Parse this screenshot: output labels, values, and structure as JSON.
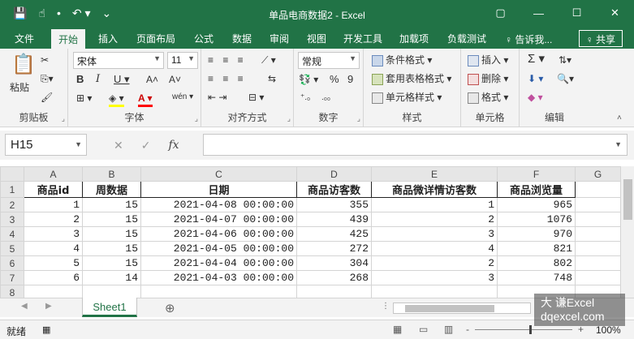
{
  "window": {
    "title": "单品电商数据2 - Excel",
    "minimize_glyph": "—",
    "restore_glyph": "▢",
    "maximize_glyph": "☐",
    "close_glyph": "✕"
  },
  "qat": {
    "save_glyph": "💾",
    "touch_glyph": "☝",
    "dot_glyph": "•",
    "undo_glyph": "↶ ▾",
    "more_glyph": "⌄"
  },
  "tabs": [
    "文件",
    "开始",
    "插入",
    "页面布局",
    "公式",
    "数据",
    "审阅",
    "视图",
    "开发工具",
    "加载项",
    "负载测试"
  ],
  "active_tab": "开始",
  "tell_me": "♀ 告诉我...",
  "share": "♀ 共享",
  "ribbon": {
    "clipboard": {
      "label": "剪贴板",
      "paste": "粘贴",
      "paste_glyph": "📋",
      "cut_glyph": "✂",
      "copy_glyph": "⎘▾",
      "painter_glyph": "🖌"
    },
    "font": {
      "label": "字体",
      "name": "宋体",
      "size": "11",
      "grow": "A˄",
      "shrink": "A˅",
      "bold": "B",
      "italic": "I",
      "underline": "U ▾",
      "border": "⊞ ▾",
      "fill": "◈ ▾",
      "color": "A ▾",
      "phonetic": "wén ▾",
      "fill_color": "#ffff00",
      "font_color": "#ff0000"
    },
    "alignment": {
      "label": "对齐方式",
      "row1": "≡ ≡ ≡",
      "row2": "≡ ≡ ≡",
      "wrap": "⇆",
      "merge": "⊟ ▾",
      "indent": "⇤ ⇥",
      "orient": "⟋ ▾"
    },
    "number": {
      "label": "数字",
      "format": "常规",
      "currency": "💱 ▾",
      "percent": "%",
      "comma": "9",
      "inc_decimal": "⁺.₀",
      "dec_decimal": ".₀₀"
    },
    "styles": {
      "label": "样式",
      "conditional": "条件格式 ▾",
      "table": "套用表格格式 ▾",
      "cell": "单元格样式 ▾"
    },
    "cells": {
      "label": "单元格",
      "insert": "插入 ▾",
      "delete": "删除 ▾",
      "format": "格式 ▾"
    },
    "editing": {
      "label": "编辑",
      "sum": "Σ ▾",
      "sort": "⇅▾",
      "fill": "⬇ ▾",
      "find": "🔍▾",
      "clear": "◆ ▾"
    }
  },
  "formula_bar": {
    "name_box": "H15",
    "cancel": "✕",
    "enter": "✓",
    "fx": "fx",
    "value": ""
  },
  "sheet": {
    "columns": [
      "A",
      "B",
      "C",
      "D",
      "E",
      "F",
      "G"
    ],
    "row_numbers": [
      "1",
      "2",
      "3",
      "4",
      "5",
      "6",
      "7",
      "8"
    ],
    "headers": [
      "商品id",
      "周数据",
      "日期",
      "商品访客数",
      "商品微详情访客数",
      "商品浏览量"
    ],
    "rows": [
      [
        "1",
        "15",
        "2021-04-08 00:00:00",
        "355",
        "1",
        "965"
      ],
      [
        "2",
        "15",
        "2021-04-07 00:00:00",
        "439",
        "2",
        "1076"
      ],
      [
        "3",
        "15",
        "2021-04-06 00:00:00",
        "425",
        "3",
        "970"
      ],
      [
        "4",
        "15",
        "2021-04-05 00:00:00",
        "272",
        "4",
        "821"
      ],
      [
        "5",
        "15",
        "2021-04-04 00:00:00",
        "304",
        "2",
        "802"
      ],
      [
        "6",
        "14",
        "2021-04-03 00:00:00",
        "268",
        "3",
        "748"
      ]
    ]
  },
  "sheet_tabs": {
    "prev": "◀",
    "next": "▶",
    "active": "Sheet1",
    "add": "⊕",
    "more": "⋮"
  },
  "status": {
    "ready": "就绪",
    "macro_icon": "▦",
    "zoom": "100%",
    "zoom_minus": "-",
    "zoom_plus": "+",
    "normal_view": "▦",
    "layout_view": "▭",
    "break_view": "▥"
  },
  "watermark": {
    "line1": "大 谦Excel",
    "line2": "dqexcel.com"
  }
}
